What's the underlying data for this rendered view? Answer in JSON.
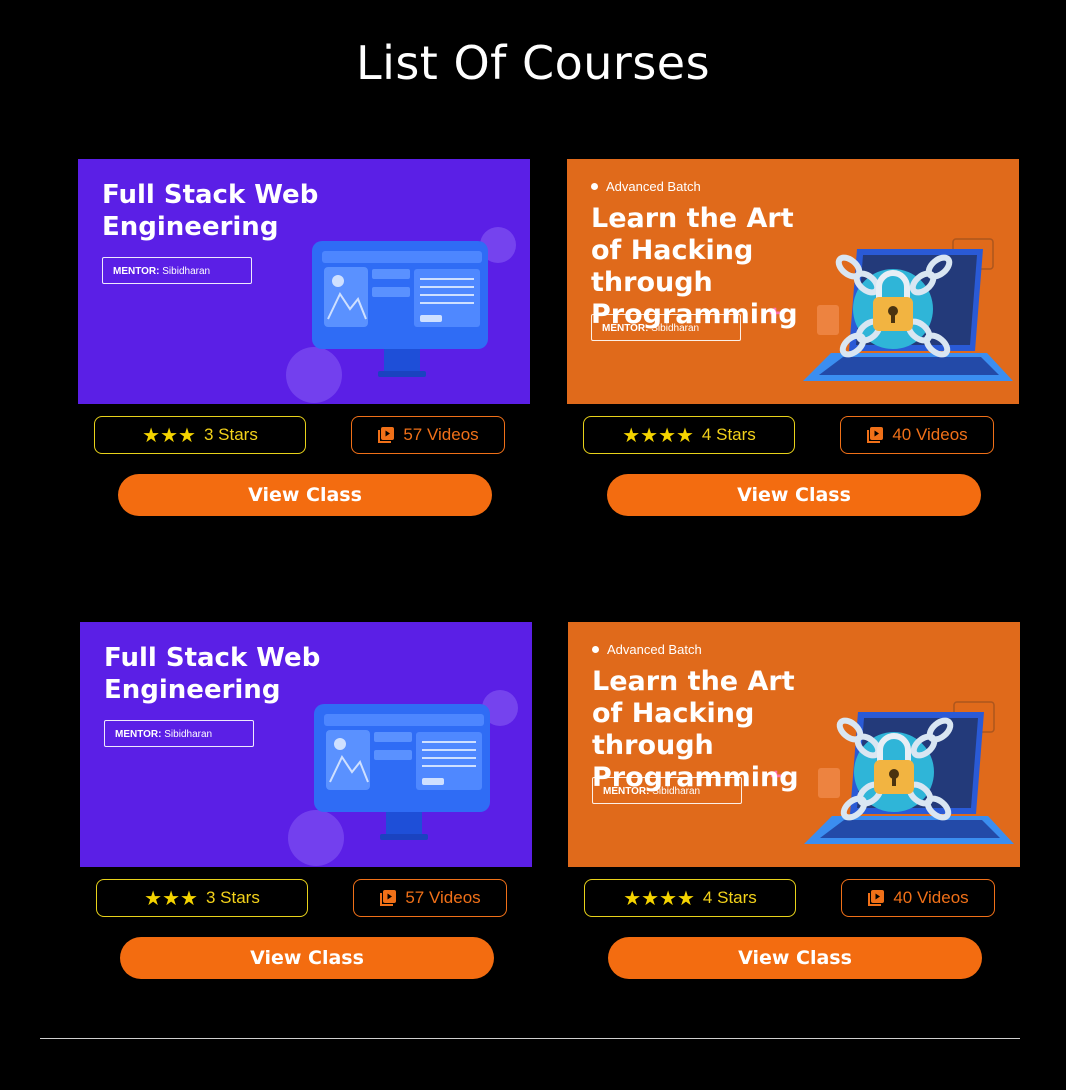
{
  "page": {
    "title": "List Of Courses"
  },
  "courses": [
    {
      "theme": "purple",
      "badge": "",
      "heading": "Full Stack Web Engineering",
      "mentor_label": "MENTOR:",
      "mentor_name": "Sibidharan",
      "star_glyphs": "★★★",
      "rating": 3,
      "stars_label": "3 Stars",
      "videos_label": "57 Videos",
      "button_label": "View Class",
      "accent": "#5b1fe6"
    },
    {
      "theme": "orange",
      "badge": "Advanced Batch",
      "heading": "Learn the Art of Hacking through Programming",
      "mentor_label": "MENTOR:",
      "mentor_name": "Sibidharan",
      "star_glyphs": "★★★★",
      "rating": 4,
      "stars_label": "4 Stars",
      "videos_label": "40 Videos",
      "button_label": "View Class",
      "accent": "#e06a1b"
    },
    {
      "theme": "purple",
      "badge": "",
      "heading": "Full Stack Web Engineering",
      "mentor_label": "MENTOR:",
      "mentor_name": "Sibidharan",
      "star_glyphs": "★★★",
      "rating": 3,
      "stars_label": "3 Stars",
      "videos_label": "57 Videos",
      "button_label": "View Class",
      "accent": "#5b1fe6"
    },
    {
      "theme": "orange",
      "badge": "Advanced Batch",
      "heading": "Learn the Art of Hacking through Programming",
      "mentor_label": "MENTOR:",
      "mentor_name": "Sibidharan",
      "star_glyphs": "★★★★",
      "rating": 4,
      "stars_label": "4 Stars",
      "videos_label": "40 Videos",
      "button_label": "View Class",
      "accent": "#e06a1b"
    }
  ],
  "colors": {
    "background": "#000000",
    "button": "#f36c10",
    "stars_border": "#e8d21a",
    "videos_border": "#f07018"
  },
  "icons": {
    "star": "star-icon",
    "videos": "video-library-icon",
    "monitor": "monitor-illustration",
    "laptop_lock": "laptop-lock-illustration"
  }
}
